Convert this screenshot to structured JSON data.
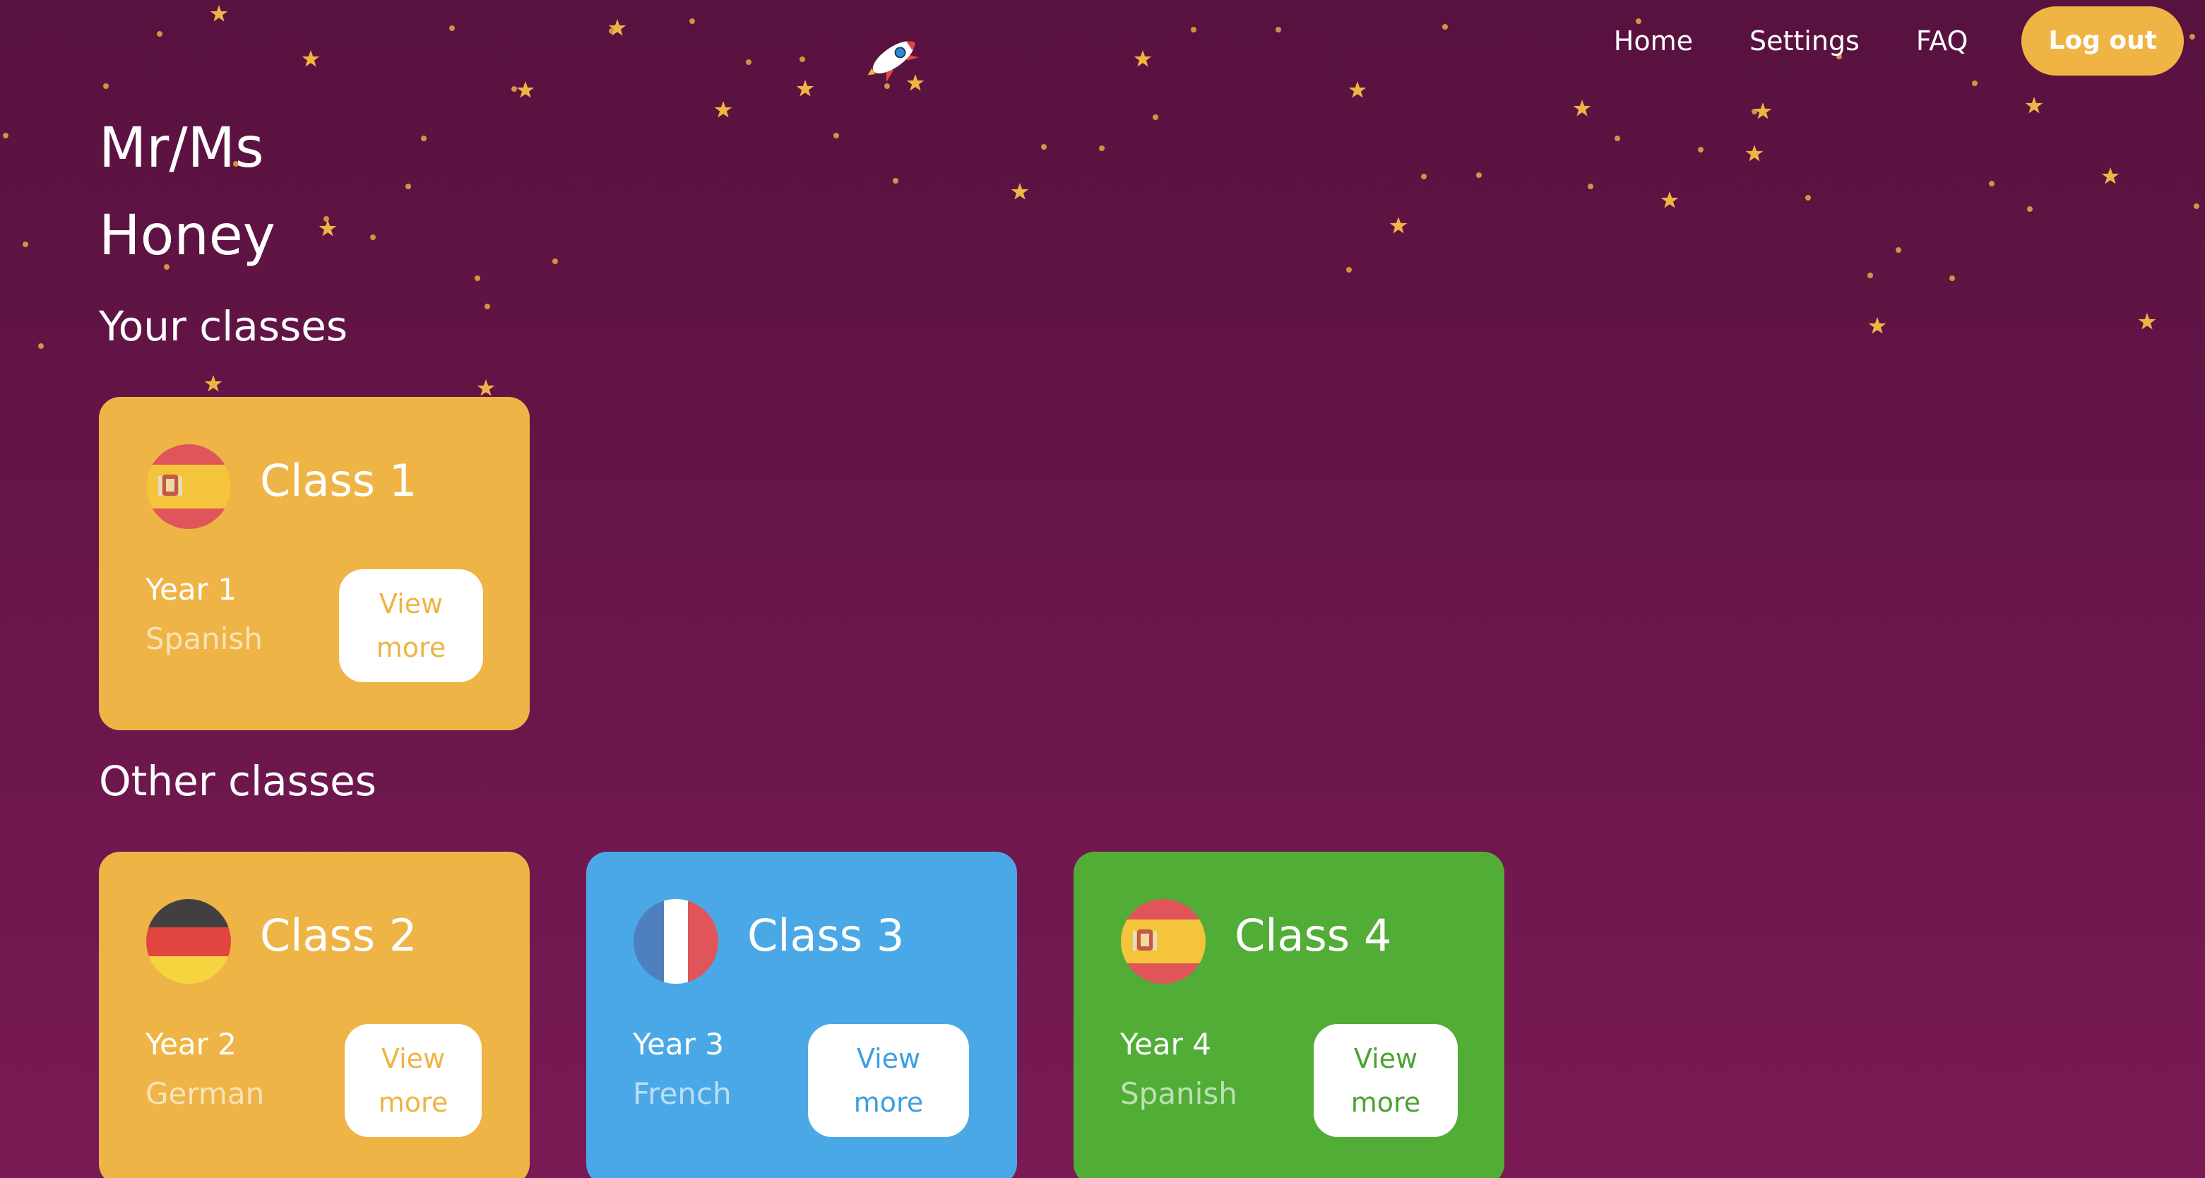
{
  "nav": {
    "logo_icon": "rocket-icon",
    "home": "Home",
    "settings": "Settings",
    "faq": "FAQ",
    "logout": "Log out"
  },
  "teacher": {
    "line1": "Mr/Ms",
    "line2": "Honey"
  },
  "sections": {
    "your_classes": "Your classes",
    "other_classes": "Other classes"
  },
  "your_classes": [
    {
      "name": "Class 1",
      "year": "Year 1",
      "language": "Spanish",
      "flag": "spain-flag-icon",
      "view_more_line1": "View",
      "view_more_line2": "more",
      "color": "#efb446"
    }
  ],
  "other_classes": [
    {
      "name": "Class 2",
      "year": "Year 2",
      "language": "German",
      "flag": "germany-flag-icon",
      "view_more_line1": "View",
      "view_more_line2": "more",
      "color": "#efb446"
    },
    {
      "name": "Class 3",
      "year": "Year 3",
      "language": "French",
      "flag": "france-flag-icon",
      "view_more_line1": "View",
      "view_more_line2": "more",
      "color": "#4ba8e6"
    },
    {
      "name": "Class 4",
      "year": "Year 4",
      "language": "Spanish",
      "flag": "spain-flag-icon",
      "view_more_line1": "View",
      "view_more_line2": "more",
      "color": "#52ad37"
    }
  ],
  "colors": {
    "background_top": "#58123f",
    "background_bottom": "#7a1a55",
    "accent_yellow": "#efb446",
    "star": "#f0b445"
  }
}
